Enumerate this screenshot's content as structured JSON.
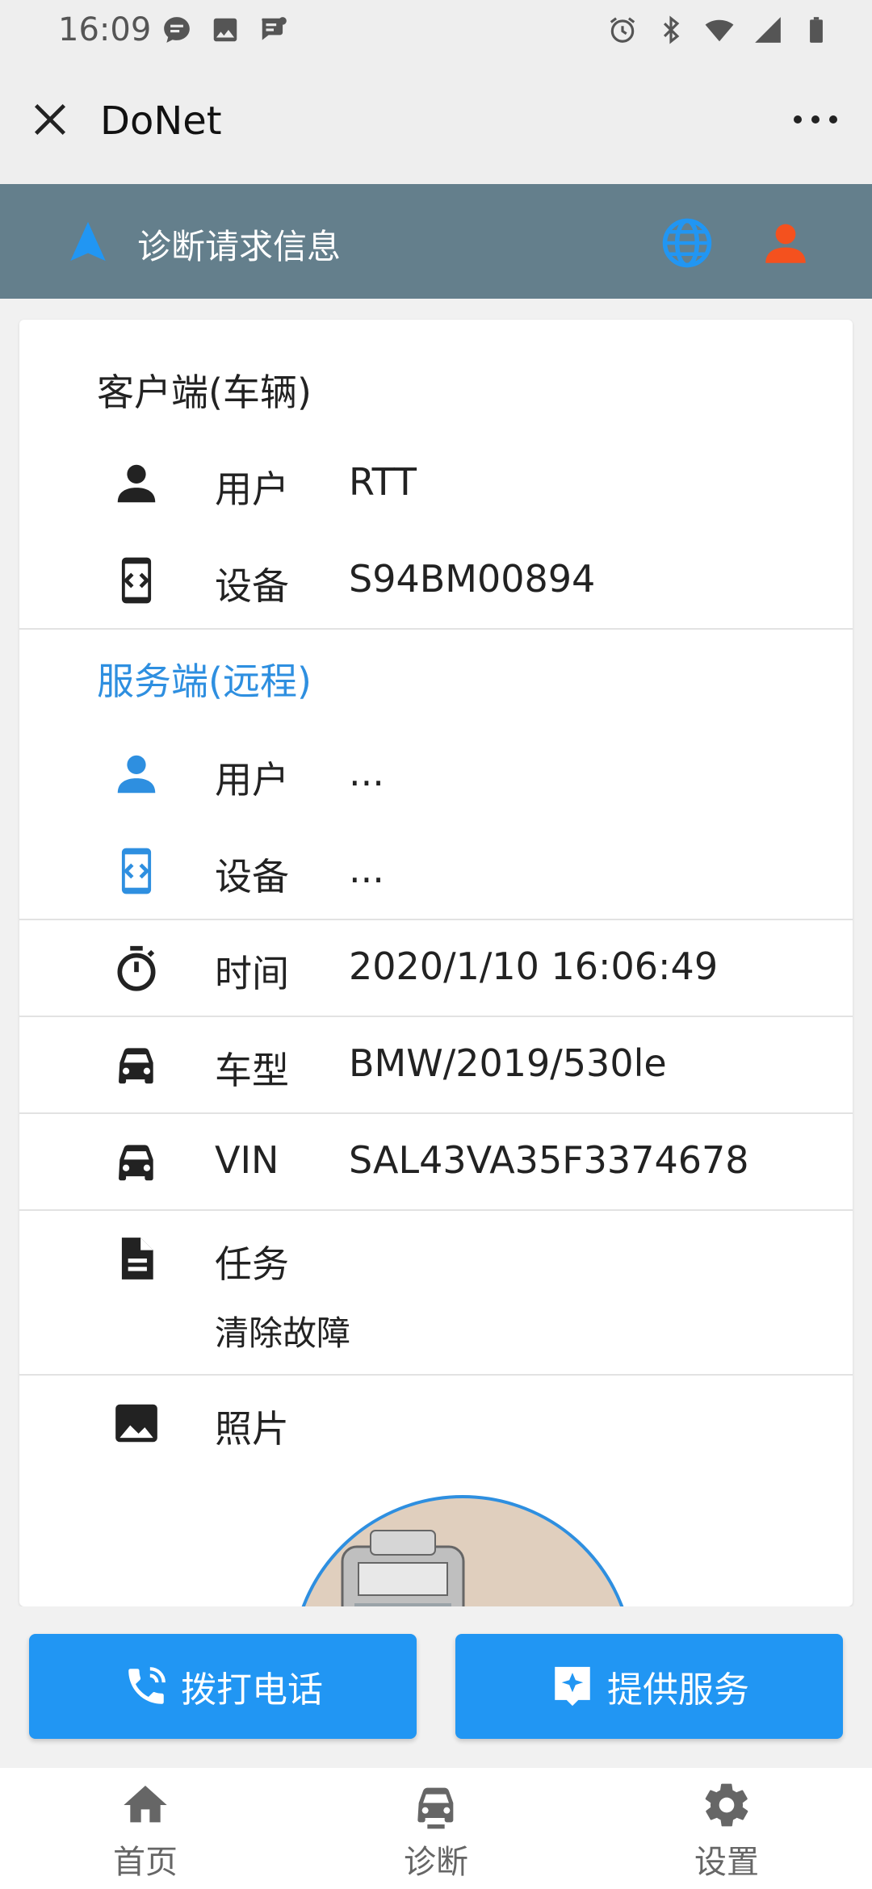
{
  "status_bar": {
    "time": "16:09"
  },
  "window": {
    "title": "DoNet"
  },
  "app_bar": {
    "title": "诊断请求信息"
  },
  "client": {
    "title": "客户端(车辆)",
    "user_label": "用户",
    "user_value": "RTT",
    "device_label": "设备",
    "device_value": "S94BM00894"
  },
  "server": {
    "title": "服务端(远程)",
    "user_label": "用户",
    "user_value": "...",
    "device_label": "设备",
    "device_value": "..."
  },
  "details": {
    "time_label": "时间",
    "time_value": "2020/1/10 16:06:49",
    "model_label": "车型",
    "model_value": "BMW/2019/530le",
    "vin_label": "VIN",
    "vin_value": "SAL43VA35F3374678",
    "task_label": "任务",
    "task_value": "清除故障",
    "photo_label": "照片"
  },
  "actions": {
    "call_label": "拨打电话",
    "service_label": "提供服务"
  },
  "bottom_nav": [
    {
      "label": "首页",
      "icon": "home-icon"
    },
    {
      "label": "诊断",
      "icon": "car-icon"
    },
    {
      "label": "设置",
      "icon": "gear-icon"
    }
  ],
  "colors": {
    "app_bar": "#647f8c",
    "accent_blue": "#2196f3",
    "server_blue": "#2e8fe0",
    "person_orange": "#f4511e"
  }
}
